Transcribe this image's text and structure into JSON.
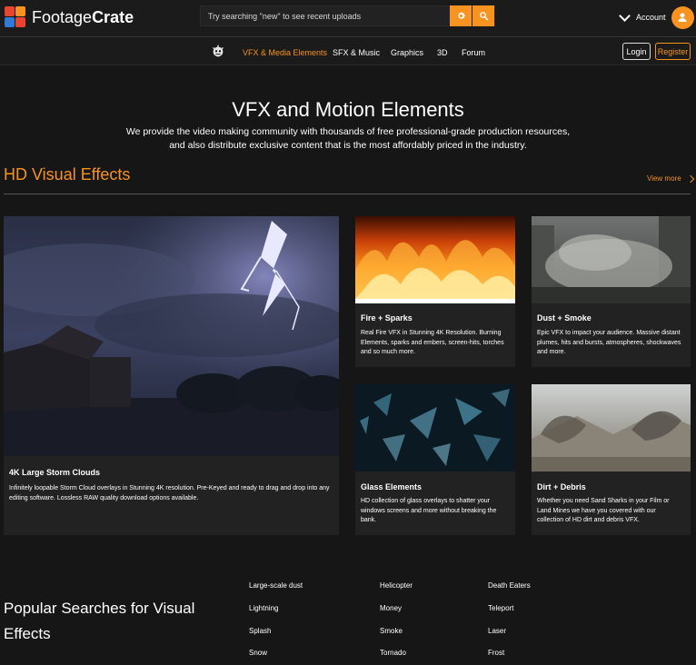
{
  "header": {
    "logo_light": "Footage",
    "logo_bold": "Crate",
    "search_placeholder": "Try searching \"new\" to see recent uploads",
    "settings_icon": "gear-icon",
    "search_icon": "search-icon",
    "account_label": "Account"
  },
  "nav": {
    "items": [
      "VFX & Media Elements",
      "SFX & Music",
      "Graphics",
      "3D",
      "Forum"
    ],
    "active_index": 0,
    "login": "Login",
    "register": "Register"
  },
  "hero": {
    "title": "VFX and Motion Elements",
    "line1": "We provide the video making community with thousands of free professional-grade production resources,",
    "line2": "and also distribute exclusive content that is the most affordably priced in the industry."
  },
  "section": {
    "title": "HD Visual Effects",
    "view_more": "View more"
  },
  "cards": [
    {
      "title": "4K Large Storm Clouds",
      "desc": "Infinitely loopable Storm Cloud overlays in Stunning 4K resolution. Pre-Keyed and ready to drag and drop into any editing software. Lossless RAW quality download options available."
    },
    {
      "title": "Fire + Sparks",
      "desc": "Real Fire VFX in Stunning 4K Resolution. Burning Elements, sparks and embers, screen-hits, torches and so much more."
    },
    {
      "title": "Dust + Smoke",
      "desc": "Epic VFX to impact your audience. Massive distant plumes, hits and bursts, atmospheres, shockwaves and more."
    },
    {
      "title": "Glass Elements",
      "desc": "HD collection of glass overlays to shatter your windows screens and more without breaking the bank."
    },
    {
      "title": "Dirt + Debris",
      "desc": "Whether you need Sand Sharks in your Film or Land Mines we have you covered with our collection of HD dirt and debris VFX."
    }
  ],
  "popular": {
    "title": "Popular Searches for Visual Effects",
    "col1": [
      "Large-scale dust",
      "Lightning",
      "Splash",
      "Snow"
    ],
    "col2": [
      "Helicopter",
      "Money",
      "Smoke",
      "Tornado"
    ],
    "col3": [
      "Death Eaters",
      "Teleport",
      "Laser",
      "Frost"
    ]
  },
  "colors": {
    "accent": "#f7931e",
    "background": "#161616",
    "card": "#222222"
  }
}
